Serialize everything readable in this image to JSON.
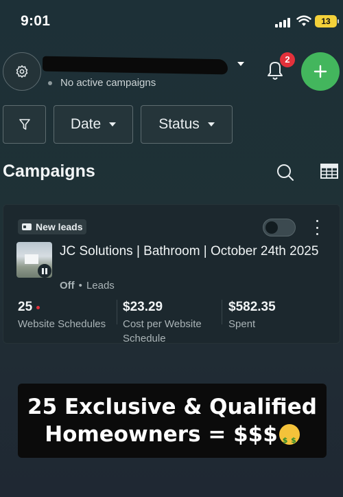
{
  "status_bar": {
    "time": "9:01",
    "battery": "13",
    "icons": [
      "signal-icon",
      "wifi-icon",
      "battery-icon"
    ]
  },
  "header": {
    "account_name_redacted": true,
    "campaign_status": "No active campaigns",
    "notification_count": "2",
    "icons": [
      "gear-icon",
      "chevron-down-icon",
      "bell-icon",
      "plus-icon"
    ]
  },
  "filters": {
    "date_label": "Date",
    "status_label": "Status",
    "icons": [
      "funnel-icon",
      "caret-down-icon"
    ]
  },
  "section": {
    "title": "Campaigns",
    "icons": [
      "search-icon",
      "table-icon"
    ]
  },
  "campaign": {
    "badge": "New leads",
    "name": "JC Solutions | Bathroom | October 24th 2025",
    "state": "Off",
    "separator": "•",
    "objective": "Leads",
    "toggle_on": false,
    "metrics": [
      {
        "value": "25",
        "label": "Website Schedules"
      },
      {
        "value": "$23.29",
        "label": "Cost per Website Schedule"
      },
      {
        "value": "$582.35",
        "label": "Spent"
      }
    ]
  },
  "caption": {
    "line1": "25 Exclusive & Qualified",
    "line2": "Homeowners = $$$"
  },
  "colors": {
    "accent_green": "#43b65d",
    "badge_red": "#e3313b",
    "battery_yellow": "#f4d13a"
  }
}
